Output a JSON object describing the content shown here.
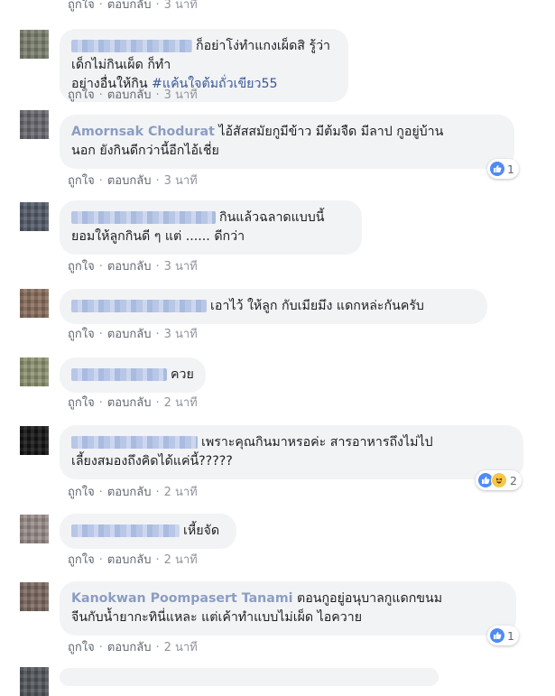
{
  "common": {
    "like_label": "ถูกใจ",
    "reply_label": "ตอบกลับ",
    "separator": "·"
  },
  "comments": [
    {
      "time": "3 นาที"
    },
    {
      "name": "Amornsak Chodurat",
      "line1": "ก็อย่าโง่ทำแกงเผ็ดสิ รู้ว่าเด็กไม่กินเผ็ด ก็ทำ",
      "line2": "อย่างอื่นให้กิน",
      "hashtag": "#แค้นใจต้มถั่วเขียว55",
      "time": "3 นาที"
    },
    {
      "name": "Amornsak Chodurat",
      "line1": "ไอ้สัสสมัยกูมีข้าว มีต้มจืด มีลาป กูอยู่บ้าน",
      "line2": "นอก ยังกินดีกว่านี้อีกไอ้เชี่ย",
      "time": "3 นาที",
      "reaction_count": "1",
      "reactions": [
        "like"
      ]
    },
    {
      "line1": "กินแล้วฉลาดแบบนี้",
      "line2": "ยอมให้ลูกกินดี ๆ แต่ ...... ดีกว่า",
      "time": "3 นาที"
    },
    {
      "line1": "เอาไว้ ให้ลูก กับเมียมึง แดกหล่ะกันครับ",
      "time": "3 นาที"
    },
    {
      "line1": "ควย",
      "time": "2 นาที"
    },
    {
      "line1": "เพราะคุณกินมาหรอค่ะ สารอาหารถึงไม่ไป",
      "line2": "เลี้ยงสมองถึงคิดได้แค่นี้?????",
      "time": "2 นาที",
      "reaction_count": "2",
      "reactions": [
        "like",
        "haha"
      ]
    },
    {
      "line1": "เหี้ยจัด",
      "time": "2 นาที"
    },
    {
      "name": "Kanokwan Poompasert Tanami",
      "line1": "ตอนกูอยู่อนุบาลกูแดกขนม",
      "line2": "จีนกับน้ำยากะทินี่แหละ แต่เค้าทำแบบไม่เผ็ด ไอควาย",
      "time": "2 นาที",
      "reaction_count": "1",
      "reactions": [
        "like"
      ]
    }
  ],
  "colors": {
    "bubble": "#f2f3f5",
    "link": "#385898",
    "hashtag": "#385898",
    "meta": "#606770",
    "like": "#4f8bf5",
    "haha": "#f7c64a"
  }
}
